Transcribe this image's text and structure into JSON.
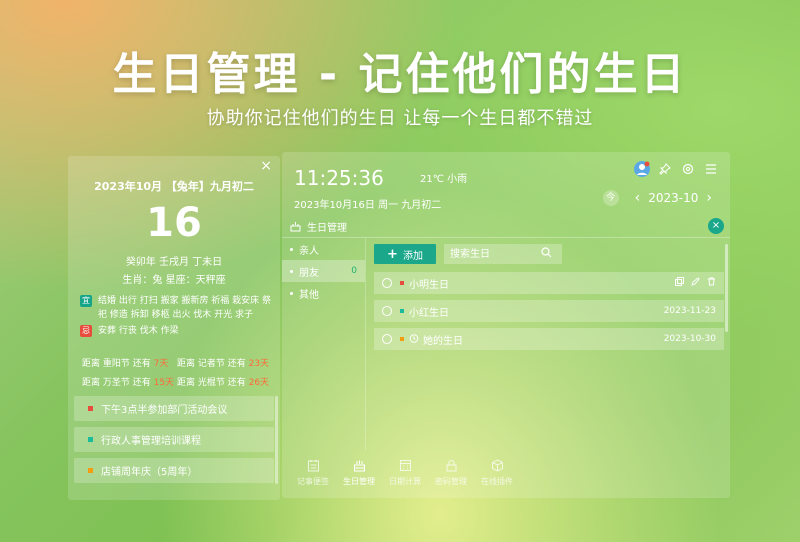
{
  "hero": {
    "title": "生日管理 - 记住他们的生日",
    "subtitle": "协助你记住他们的生日 让每一个生日都不错过"
  },
  "calendar": {
    "close": "×",
    "date_header": "2023年10月 【兔年】九月初二",
    "day": "16",
    "ganzhi": "癸卯年 壬戌月 丁未日",
    "zodiac": "生肖：兔   星座：天秤座",
    "yi_badge": "宜",
    "yi_text": "结婚 出行 打扫 搬家 搬新房 祈福 栽安床 祭祀 修造 拆卸 移柩 出火 伐木 开光 求子",
    "ji_badge": "忌",
    "ji_text": "安葬 行丧 伐木 作梁",
    "countdowns": [
      {
        "pre": "距离 重阳节 还有 ",
        "num": "7天"
      },
      {
        "pre": "距离 记者节 还有 ",
        "num": "23天"
      },
      {
        "pre": "距离 万圣节 还有 ",
        "num": "15天"
      },
      {
        "pre": "距离 光棍节 还有 ",
        "num": "26天"
      }
    ],
    "memos": [
      {
        "text": "下午3点半参加部门活动会议",
        "color": "#e74c3c"
      },
      {
        "text": "行政人事管理培训课程",
        "color": "#1abc9c"
      },
      {
        "text": "店铺周年庆（5周年）",
        "color": "#f39c12"
      }
    ]
  },
  "header": {
    "time": "11:25:36",
    "weather": "21℃ 小雨",
    "full_date": "2023年10月16日 周一 九月初二",
    "today_label": "今",
    "prev": "‹",
    "next": "›",
    "month": "2023-10"
  },
  "module": {
    "title": "生日管理",
    "close": "×"
  },
  "groups": [
    {
      "label": "亲人",
      "count": ""
    },
    {
      "label": "朋友",
      "count": "0"
    },
    {
      "label": "其他",
      "count": ""
    }
  ],
  "toolbar": {
    "add_label": "添加",
    "search_placeholder": "搜索生日"
  },
  "birthdays": [
    {
      "name": "小明生日",
      "date": "",
      "color": "#e74c3c",
      "alarm": false
    },
    {
      "name": "小红生日",
      "date": "2023-11-23",
      "color": "#1abc9c",
      "alarm": false
    },
    {
      "name": "她的生日",
      "date": "2023-10-30",
      "color": "#f39c12",
      "alarm": true
    }
  ],
  "tabs": [
    {
      "label": "记事便签"
    },
    {
      "label": "生日管理"
    },
    {
      "label": "日期计算"
    },
    {
      "label": "密码管理"
    },
    {
      "label": "在线插件"
    }
  ],
  "colors": {
    "accent": "#1aa78a",
    "countdown_highlight": "#ff6a3a"
  }
}
